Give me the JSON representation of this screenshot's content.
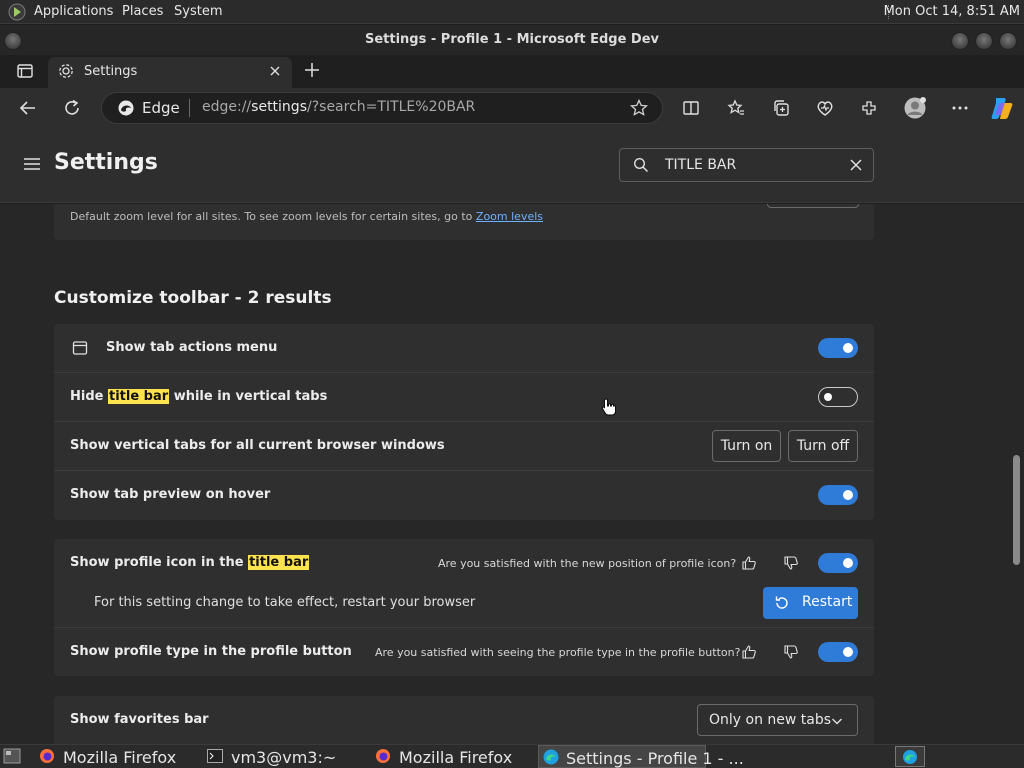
{
  "panel": {
    "menus": [
      "Applications",
      "Places",
      "System"
    ],
    "clock": "Mon Oct 14,  8:51 AM"
  },
  "window": {
    "title": "Settings - Profile 1 - Microsoft Edge Dev"
  },
  "tabs": [
    {
      "label": "Settings"
    }
  ],
  "address_bar": {
    "brand": "Edge",
    "url_prefix": "edge://",
    "url_host": "settings",
    "url_rest": "/?search=TITLE%20BAR"
  },
  "settings": {
    "title": "Settings",
    "search_value": "TITLE BAR",
    "zoom_text": "Default zoom level for all sites. To see zoom levels for certain sites, go to",
    "zoom_link": "Zoom levels",
    "section_title": "Customize toolbar - 2 results",
    "rows": {
      "tab_actions": {
        "label": "Show tab actions menu",
        "toggle": "on"
      },
      "hide_title_bar": {
        "label_before": "Hide ",
        "label_highlight": "title bar",
        "label_after": " while in vertical tabs",
        "toggle": "off"
      },
      "vertical_tabs": {
        "label": "Show vertical tabs for all current browser windows",
        "turn_on": "Turn on",
        "turn_off": "Turn off"
      },
      "tab_preview": {
        "label": "Show tab preview on hover",
        "toggle": "on"
      },
      "profile_icon": {
        "label_before": "Show profile icon in the ",
        "label_highlight": "title bar",
        "question": "Are you satisfied with the new position of profile icon?",
        "toggle": "on"
      },
      "restart_notice": {
        "text": "For this setting change to take effect, restart your browser",
        "button": "Restart"
      },
      "profile_type": {
        "label": "Show profile type in the profile button",
        "question": "Are you satisfied with seeing the profile type in the profile button?",
        "toggle": "on"
      },
      "favorites_bar": {
        "label": "Show favorites bar",
        "select_value": "Only on new tabs"
      }
    }
  },
  "taskbar": {
    "items": [
      "Mozilla Firefox",
      "vm3@vm3:~",
      "Mozilla Firefox",
      "Settings - Profile 1 - ..."
    ]
  },
  "colors": {
    "accent": "#2f7bd8",
    "highlight": "#ffe34d",
    "background": "#272727",
    "card": "#2f2f2f"
  }
}
